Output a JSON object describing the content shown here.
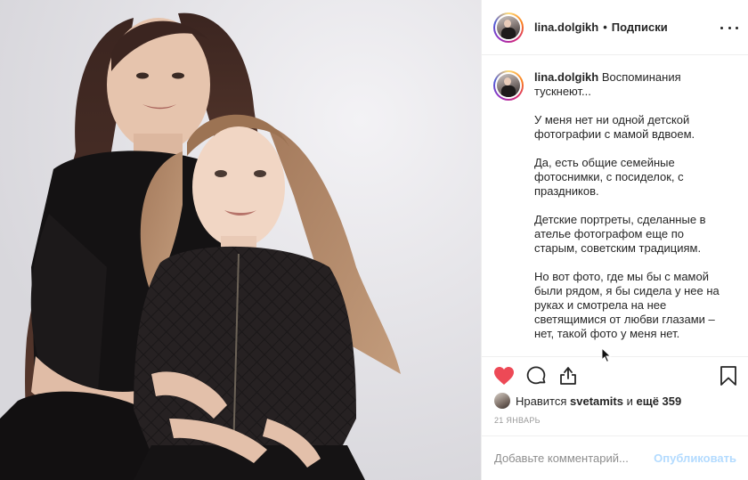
{
  "header": {
    "username": "lina.dolgikh",
    "dot": "•",
    "follow_label": "Подписки"
  },
  "caption": {
    "username": "lina.dolgikh",
    "paragraphs": [
      "Воспоминания тускнеют...",
      "У меня нет ни одной детской фотографии с мамой вдвоем.",
      "Да, есть общие семейные фотоснимки, с посиделок, с праздников.",
      "Детские портреты, сделанные в ателье фотографом еще по старым, советским традициям.",
      "Но вот фото, где мы бы с мамой были рядом, я бы сидела у нее на руках и смотрела на нее светящимися от любви глазами – нет, такой фото у меня нет."
    ]
  },
  "likes": {
    "prefix": "Нравится",
    "user": "svetamits",
    "middle": "и",
    "others": "ещё 359"
  },
  "date": "21 ЯНВАРЬ",
  "comment": {
    "placeholder": "Добавьте комментарий...",
    "publish_label": "Опубликовать"
  },
  "icons": {
    "like": "heart-icon",
    "comment": "comment-icon",
    "share": "share-icon",
    "save": "bookmark-icon",
    "more": "more-icon"
  },
  "colors": {
    "like_active": "#ed4956",
    "publish_disabled": "#b3dbff",
    "secondary_text": "#999999"
  }
}
